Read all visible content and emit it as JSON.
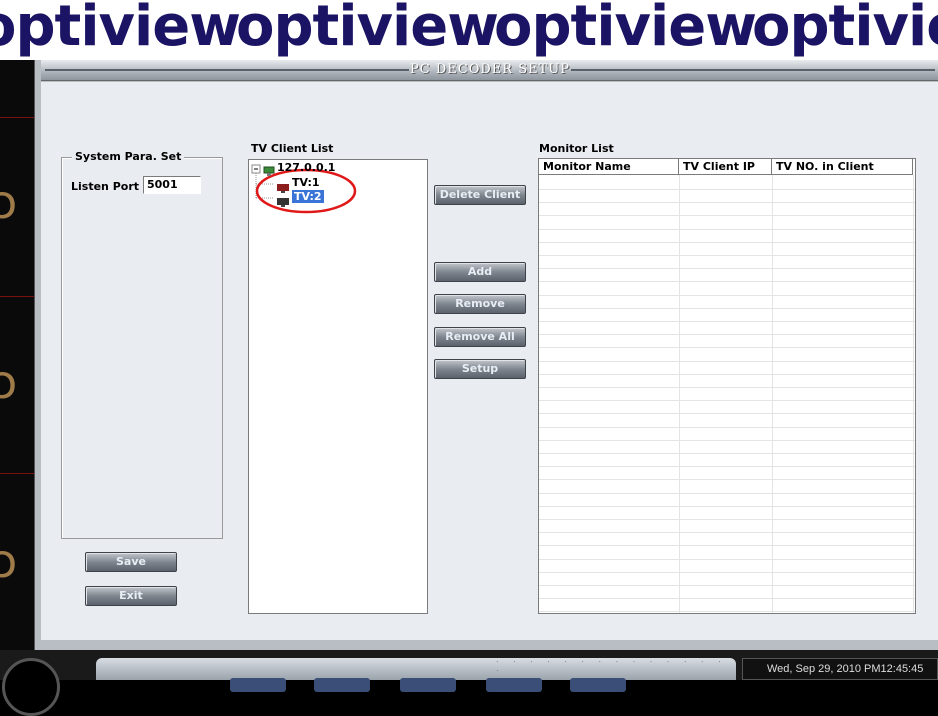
{
  "banner": {
    "brand": "optiview"
  },
  "window": {
    "title": "PC DECODER SETUP"
  },
  "system": {
    "group_title": "System Para. Set",
    "listen_port_label": "Listen Port",
    "listen_port_value": "5001"
  },
  "tv_client": {
    "title": "TV Client List",
    "tree": {
      "root": "127.0.0.1",
      "children": [
        "TV:1",
        "TV:2"
      ],
      "selected": "TV:2"
    }
  },
  "buttons": {
    "delete_client": "Delete Client",
    "add": "Add",
    "remove": "Remove",
    "remove_all": "Remove All",
    "setup": "Setup",
    "save": "Save",
    "exit": "Exit"
  },
  "monitor": {
    "title": "Monitor List",
    "columns": [
      "Monitor Name",
      "TV Client IP",
      "TV NO. in Client"
    ],
    "rows": []
  },
  "taskbar": {
    "clock": "Wed, Sep 29, 2010  PM12:45:45"
  },
  "colors": {
    "selection": "#3a74d6",
    "annotation_circle": "#e01818",
    "window_bg": "#e9edf2"
  }
}
